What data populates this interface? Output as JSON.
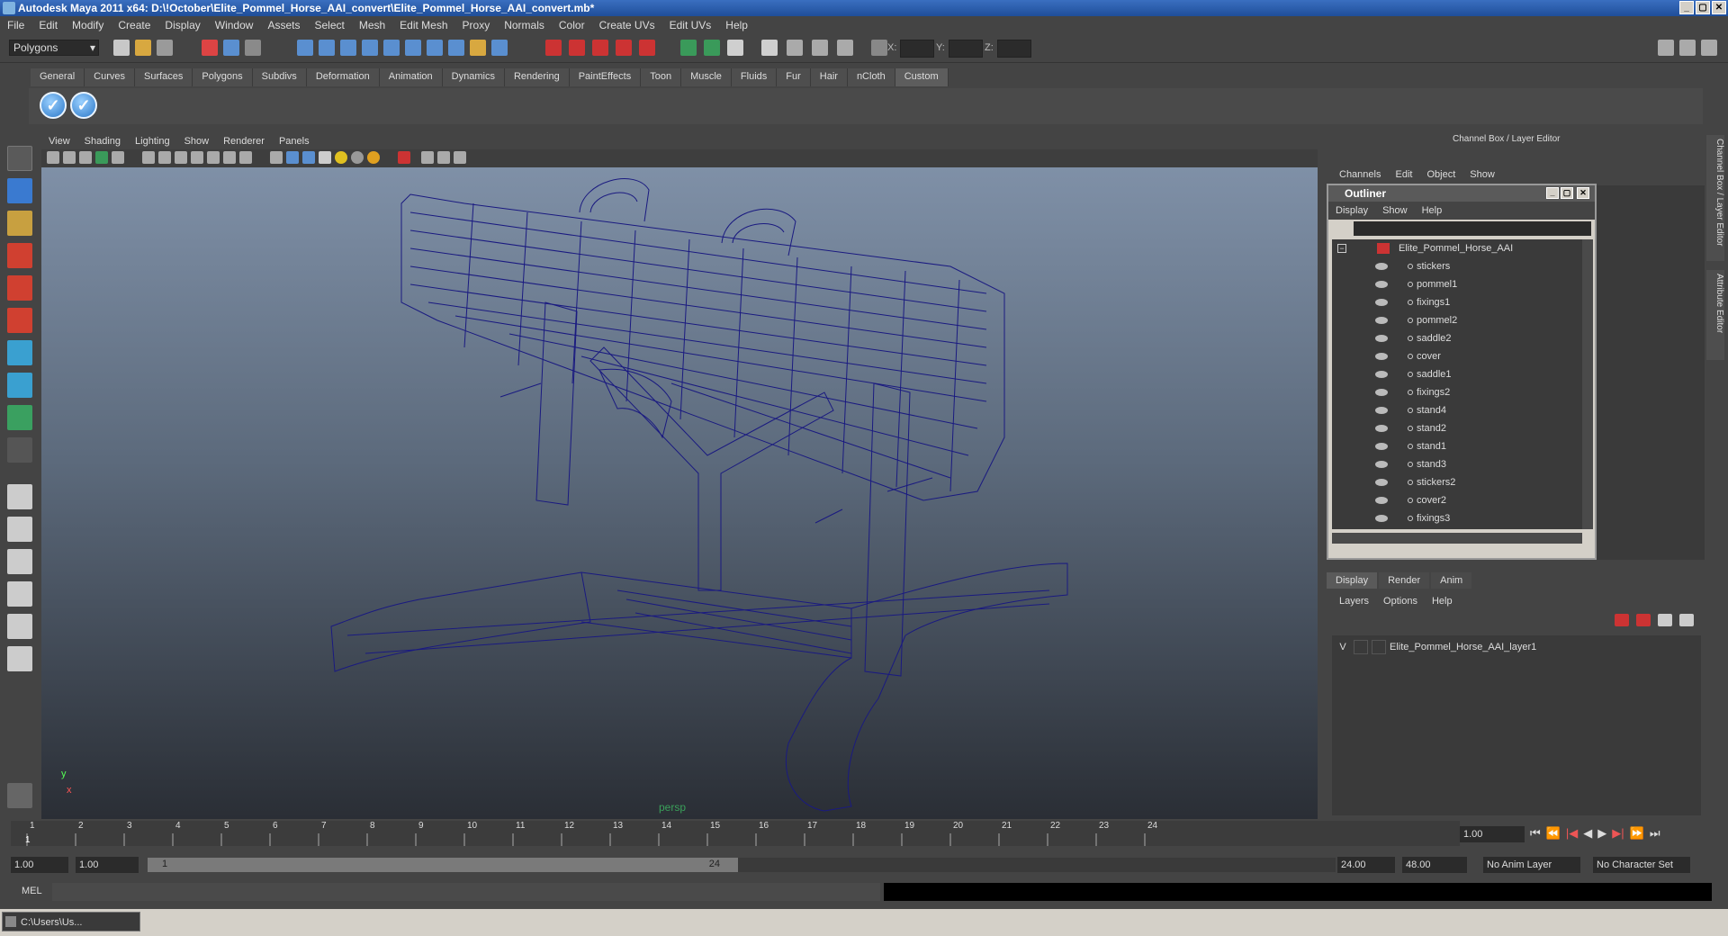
{
  "window": {
    "title": "Autodesk Maya 2011 x64: D:\\!October\\Elite_Pommel_Horse_AAI_convert\\Elite_Pommel_Horse_AAI_convert.mb*"
  },
  "menubar": [
    "File",
    "Edit",
    "Modify",
    "Create",
    "Display",
    "Window",
    "Assets",
    "Select",
    "Mesh",
    "Edit Mesh",
    "Proxy",
    "Normals",
    "Color",
    "Create UVs",
    "Edit UVs",
    "Help"
  ],
  "status": {
    "mode": "Polygons",
    "x_label": "X:",
    "y_label": "Y:",
    "z_label": "Z:"
  },
  "shelf": {
    "tabs": [
      "General",
      "Curves",
      "Surfaces",
      "Polygons",
      "Subdivs",
      "Deformation",
      "Animation",
      "Dynamics",
      "Rendering",
      "PaintEffects",
      "Toon",
      "Muscle",
      "Fluids",
      "Fur",
      "Hair",
      "nCloth",
      "Custom"
    ],
    "active": "Custom"
  },
  "viewport": {
    "menu": [
      "View",
      "Shading",
      "Lighting",
      "Show",
      "Renderer",
      "Panels"
    ],
    "camera": "persp",
    "axis_y": "y",
    "axis_x": "x",
    "wire_color": "#1a1a80"
  },
  "channel_box": {
    "title": "Channel Box / Layer Editor",
    "menu": [
      "Channels",
      "Edit",
      "Object",
      "Show"
    ],
    "side_tab1": "Channel Box / Layer Editor",
    "side_tab2": "Attribute Editor"
  },
  "outliner": {
    "title": "Outliner",
    "menu": [
      "Display",
      "Show",
      "Help"
    ],
    "root": "Elite_Pommel_Horse_AAI",
    "items": [
      "stickers",
      "pommel1",
      "fixings1",
      "pommel2",
      "saddle2",
      "cover",
      "saddle1",
      "fixings2",
      "stand4",
      "stand2",
      "stand1",
      "stand3",
      "stickers2",
      "cover2",
      "fixings3"
    ]
  },
  "layer_editor": {
    "tabs": [
      "Display",
      "Render",
      "Anim"
    ],
    "active": "Display",
    "menu": [
      "Layers",
      "Options",
      "Help"
    ],
    "layer": {
      "visible": "V",
      "name": "Elite_Pommel_Horse_AAI_layer1"
    }
  },
  "time_slider": {
    "ticks": [
      "1",
      "2",
      "3",
      "4",
      "5",
      "6",
      "7",
      "8",
      "9",
      "10",
      "11",
      "12",
      "13",
      "14",
      "15",
      "16",
      "17",
      "18",
      "19",
      "20",
      "21",
      "22",
      "23",
      "24"
    ],
    "current": "1.00"
  },
  "range": {
    "start": "1.00",
    "start2": "1.00",
    "inner_start": "1",
    "inner_end": "24",
    "end": "24.00",
    "end2": "48.00",
    "anim_layer": "No Anim Layer",
    "char_set": "No Character Set"
  },
  "command_line": {
    "label": "MEL"
  },
  "taskbar": {
    "item": "C:\\Users\\Us..."
  }
}
